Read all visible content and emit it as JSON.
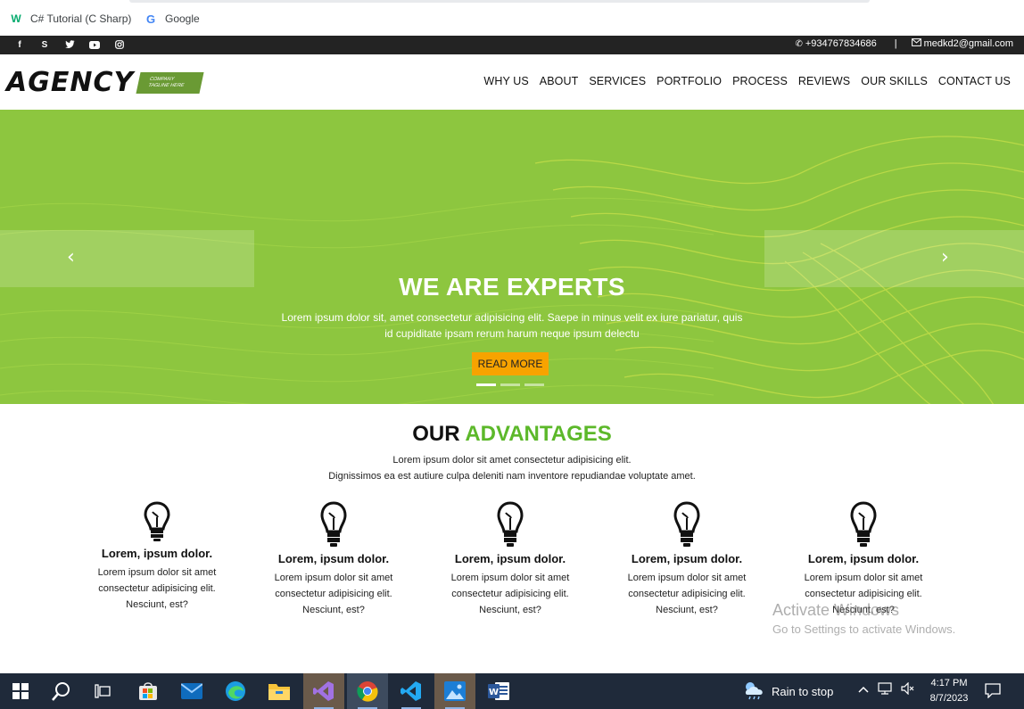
{
  "bookmarks": [
    {
      "label": "C# Tutorial (C Sharp)",
      "icon": "w3schools-icon"
    },
    {
      "label": "Google",
      "icon": "google-icon"
    }
  ],
  "topbar": {
    "social": [
      "facebook-icon",
      "skype-icon",
      "twitter-icon",
      "youtube-icon",
      "instagram-icon"
    ],
    "phone": "+934767834686",
    "separator": "|",
    "email": "medkd2@gmail.com"
  },
  "header": {
    "logo": "AGENCY",
    "tagline1": "COMPANY",
    "tagline2": "TAGLINE HERE",
    "nav": [
      "WHY US",
      "ABOUT",
      "SERVICES",
      "PORTFOLIO",
      "PROCESS",
      "REVIEWS",
      "OUR SKILLS",
      "CONTACT US"
    ]
  },
  "hero": {
    "title": "WE ARE EXPERTS",
    "text": "Lorem ipsum dolor sit, amet consectetur adipisicing elit. Saepe in minus velit ex iure pariatur, quis id cupiditate ipsam rerum harum neque ipsum delectu",
    "button": "READ MORE",
    "prev": "‹",
    "next": "›"
  },
  "advantages": {
    "title_dark": "OUR",
    "title_green": "ADVANTAGES",
    "sub1": "Lorem ipsum dolor sit amet consectetur adipisicing elit.",
    "sub2": "Dignissimos ea est autiure culpa deleniti nam inventore repudiandae voluptate amet.",
    "cards": [
      {
        "title": "Lorem, ipsum dolor.",
        "text": "Lorem ipsum dolor sit amet consectetur adipisicing elit. Nesciunt, est?"
      },
      {
        "title": "Lorem, ipsum dolor.",
        "text": "Lorem ipsum dolor sit amet consectetur adipisicing elit. Nesciunt, est?"
      },
      {
        "title": "Lorem, ipsum dolor.",
        "text": "Lorem ipsum dolor sit amet consectetur adipisicing elit. Nesciunt, est?"
      },
      {
        "title": "Lorem, ipsum dolor.",
        "text": "Lorem ipsum dolor sit amet consectetur adipisicing elit. Nesciunt, est?"
      },
      {
        "title": "Lorem, ipsum dolor.",
        "text": "Lorem ipsum dolor sit amet consectetur adipisicing elit. Nesciunt, est?"
      }
    ]
  },
  "watermark": {
    "line1": "Activate Windows",
    "line2": "Go to Settings to activate Windows."
  },
  "taskbar": {
    "weather": "Rain to stop",
    "time": "4:17 PM",
    "date": "8/7/2023"
  },
  "colors": {
    "hero_bg": "#8dc63f",
    "accent_green": "#5cb82a",
    "button": "#f7a300",
    "topbar": "#232323",
    "taskbar": "#1f2a3a"
  }
}
